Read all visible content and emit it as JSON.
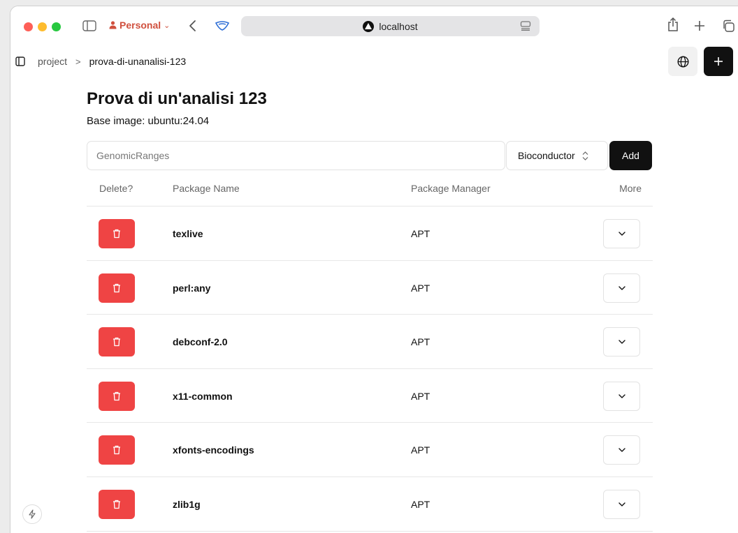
{
  "browser": {
    "profile_label": "Personal",
    "url": "localhost"
  },
  "breadcrumb": {
    "parent": "project",
    "separator": ">",
    "current": "prova-di-unanalisi-123"
  },
  "page": {
    "title": "Prova di un'analisi 123",
    "subtitle": "Base image: ubuntu:24.04"
  },
  "add_form": {
    "input_placeholder": "GenomicRanges",
    "selected_manager": "Bioconductor",
    "add_label": "Add"
  },
  "table": {
    "headers": {
      "delete": "Delete?",
      "name": "Package Name",
      "manager": "Package Manager",
      "more": "More"
    },
    "rows": [
      {
        "name": "texlive",
        "manager": "APT"
      },
      {
        "name": "perl:any",
        "manager": "APT"
      },
      {
        "name": "debconf-2.0",
        "manager": "APT"
      },
      {
        "name": "x11-common",
        "manager": "APT"
      },
      {
        "name": "xfonts-encodings",
        "manager": "APT"
      },
      {
        "name": "zlib1g",
        "manager": "APT"
      }
    ]
  },
  "colors": {
    "delete_red": "#ef4444",
    "primary_black": "#111111",
    "profile_accent": "#d0503e"
  },
  "icons": {
    "row_delete": "trash-icon",
    "row_more": "chevron-down-icon",
    "globe": "globe-icon",
    "new": "plus-icon"
  }
}
